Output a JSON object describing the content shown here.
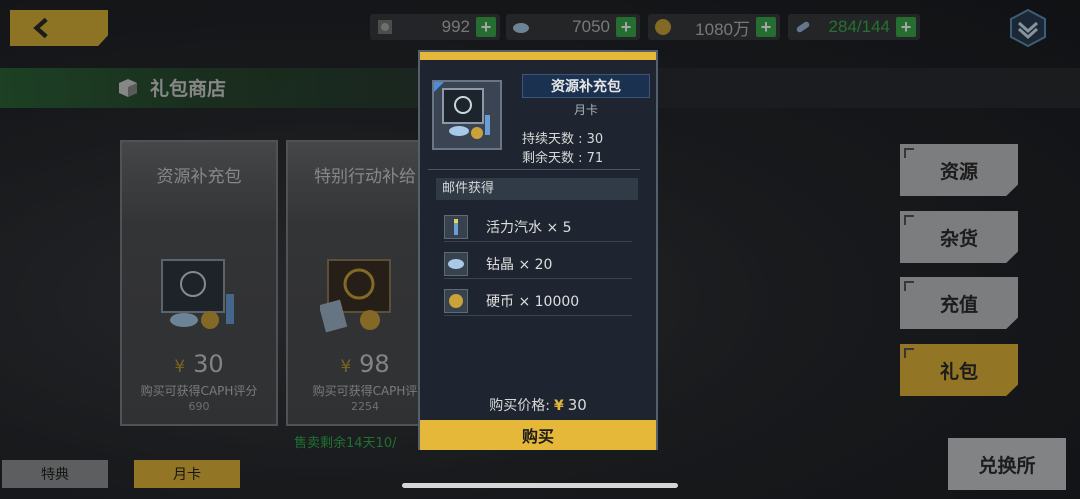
{
  "currency": [
    {
      "name": "stamina",
      "value": "992",
      "icon": "stamina-icon"
    },
    {
      "name": "crystal",
      "value": "7050",
      "icon": "crystal-icon"
    },
    {
      "name": "coin",
      "value": "1080万",
      "icon": "coin-icon"
    },
    {
      "name": "energy",
      "value": "284/144",
      "icon": "energy-icon"
    }
  ],
  "shop": {
    "title": "礼包商店"
  },
  "cards": [
    {
      "name": "资源补充包",
      "price": "30",
      "hint": "购买可获得CAPH评分",
      "score": "690"
    },
    {
      "name": "特别行动补给",
      "price": "98",
      "hint": "购买可获得CAPH评",
      "score": "2254"
    }
  ],
  "sale_note": "售卖剩余14天10/",
  "side_tabs": [
    "资源",
    "杂货",
    "充值",
    "礼包"
  ],
  "exchange": "兑换所",
  "bottom_tabs": [
    "特典",
    "月卡"
  ],
  "popup": {
    "name": "资源补充包",
    "type": "月卡",
    "duration": "持续天数 : 30",
    "remaining": "剩余天数 : 71",
    "mail_title": "邮件获得",
    "rewards": [
      {
        "label": "活力汽水 × 5",
        "icon": "soda-icon"
      },
      {
        "label": "钻晶 × 20",
        "icon": "crystal-icon"
      },
      {
        "label": "硬币 × 10000",
        "icon": "coin-icon"
      }
    ],
    "price_label": "购买价格:",
    "currency_symbol": "¥",
    "price": "30",
    "buy": "购买"
  },
  "colors": {
    "accent": "#e6b83a",
    "plus": "#3aa84a",
    "sale": "#2fae4c"
  }
}
